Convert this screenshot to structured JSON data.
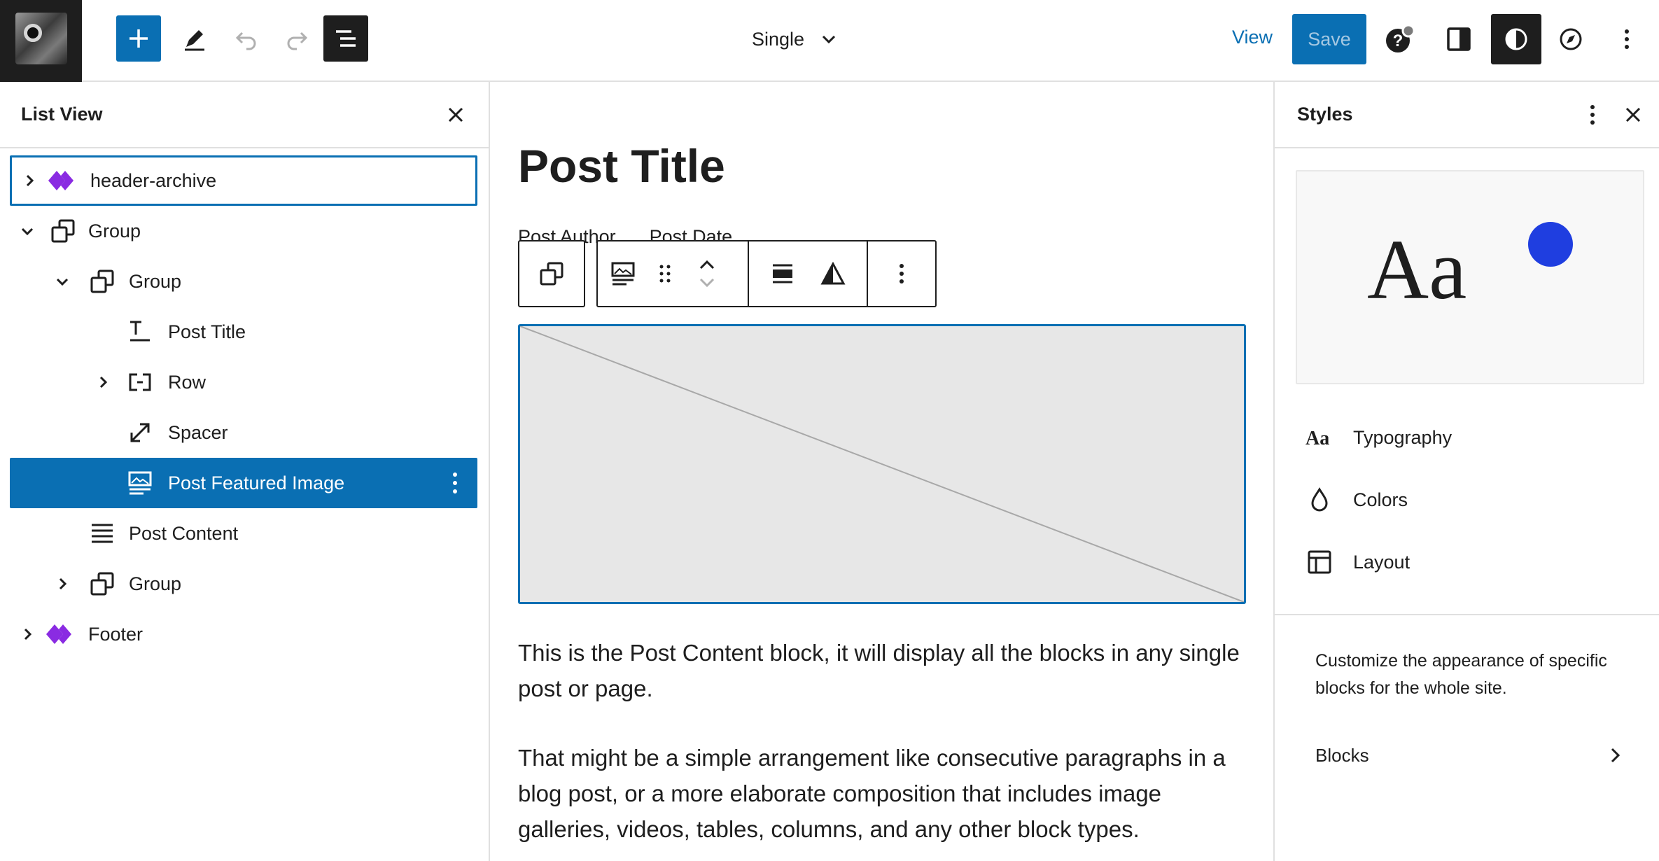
{
  "topbar": {
    "document_title": "Single",
    "view_label": "View",
    "save_label": "Save"
  },
  "list_view": {
    "title": "List View",
    "items": [
      {
        "label": "header-archive",
        "icon": "template-part-icon"
      },
      {
        "label": "Group",
        "icon": "group-icon"
      },
      {
        "label": "Group",
        "icon": "group-icon"
      },
      {
        "label": "Post Title",
        "icon": "post-title-icon"
      },
      {
        "label": "Row",
        "icon": "row-icon"
      },
      {
        "label": "Spacer",
        "icon": "spacer-icon"
      },
      {
        "label": "Post Featured Image",
        "icon": "featured-image-icon"
      },
      {
        "label": "Post Content",
        "icon": "post-content-icon"
      },
      {
        "label": "Group",
        "icon": "group-icon"
      },
      {
        "label": "Footer",
        "icon": "template-part-icon"
      }
    ]
  },
  "canvas": {
    "post_title": "Post Title",
    "post_author": "Post Author",
    "post_date": "Post Date",
    "paragraph_1": "This is the Post Content block, it will display all the blocks in any single post or page.",
    "paragraph_2": "That might be a simple arrangement like consecutive paragraphs in a blog post, or a more elaborate composition that includes image galleries, videos, tables, columns, and any other block types."
  },
  "styles": {
    "title": "Styles",
    "preview_text": "Aa",
    "nav": [
      {
        "label": "Typography",
        "icon": "typography-icon"
      },
      {
        "label": "Colors",
        "icon": "droplet-icon"
      },
      {
        "label": "Layout",
        "icon": "layout-icon"
      }
    ],
    "description": "Customize the appearance of specific blocks for the whole site.",
    "blocks_label": "Blocks"
  },
  "colors": {
    "accent": "#0a6fb3",
    "preview_dot": "#1f3ee0",
    "template_part": "#8a2be2"
  }
}
